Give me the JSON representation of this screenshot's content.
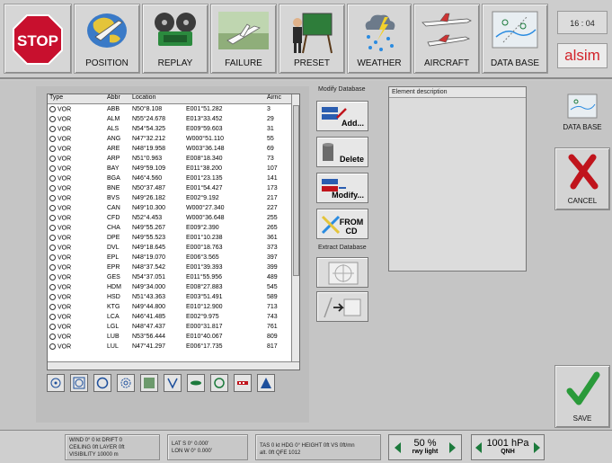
{
  "toolbar": {
    "stop": "STOP",
    "position": "POSITION",
    "replay": "REPLAY",
    "failure": "FAILURE",
    "preset": "PRESET",
    "weather": "WEATHER",
    "aircraft": "AIRCRAFT",
    "database": "DATA BASE",
    "clock": "16 : 04",
    "brand": "alsim"
  },
  "list": {
    "headers": [
      "Type",
      "Abbr",
      "Location",
      "Airnc"
    ],
    "rows": [
      [
        "VOR",
        "ABB",
        "N50°8.108",
        "E001°51.282",
        "3"
      ],
      [
        "VOR",
        "ALM",
        "N55°24.678",
        "E013°33.452",
        "29"
      ],
      [
        "VOR",
        "ALS",
        "N54°54.325",
        "E009°59.603",
        "31"
      ],
      [
        "VOR",
        "ANG",
        "N47°32.212",
        "W000°51.110",
        "55"
      ],
      [
        "VOR",
        "ARE",
        "N48°19.958",
        "W003°36.148",
        "69"
      ],
      [
        "VOR",
        "ARP",
        "N51°0.963",
        "E008°18.340",
        "73"
      ],
      [
        "VOR",
        "BAY",
        "N49°59.109",
        "E011°38.200",
        "107"
      ],
      [
        "VOR",
        "BGA",
        "N46°4.560",
        "E001°23.135",
        "141"
      ],
      [
        "VOR",
        "BNE",
        "N50°37.487",
        "E001°54.427",
        "173"
      ],
      [
        "VOR",
        "BVS",
        "N49°26.182",
        "E002°9.192",
        "217"
      ],
      [
        "VOR",
        "CAN",
        "N49°10.300",
        "W000°27.340",
        "227"
      ],
      [
        "VOR",
        "CFD",
        "N52°4.453",
        "W000°36.648",
        "255"
      ],
      [
        "VOR",
        "CHA",
        "N49°55.267",
        "E009°2.390",
        "265"
      ],
      [
        "VOR",
        "DPE",
        "N49°55.523",
        "E001°10.238",
        "361"
      ],
      [
        "VOR",
        "DVL",
        "N49°18.645",
        "E000°18.763",
        "373"
      ],
      [
        "VOR",
        "EPL",
        "N48°19.070",
        "E006°3.565",
        "397"
      ],
      [
        "VOR",
        "EPR",
        "N48°37.542",
        "E001°39.393",
        "399"
      ],
      [
        "VOR",
        "GES",
        "N54°37.051",
        "E011°55.956",
        "489"
      ],
      [
        "VOR",
        "HDM",
        "N49°34.000",
        "E008°27.883",
        "545"
      ],
      [
        "VOR",
        "HSD",
        "N51°43.363",
        "E003°51.491",
        "589"
      ],
      [
        "VOR",
        "KTG",
        "N49°44.800",
        "E010°12.900",
        "713"
      ],
      [
        "VOR",
        "LCA",
        "N46°41.485",
        "E002°9.975",
        "743"
      ],
      [
        "VOR",
        "LGL",
        "N48°47.437",
        "E000°31.817",
        "761"
      ],
      [
        "VOR",
        "LUB",
        "N53°56.444",
        "E010°40.067",
        "809"
      ],
      [
        "VOR",
        "LUL",
        "N47°41.297",
        "E006°17.735",
        "817"
      ]
    ]
  },
  "modify": {
    "title": "Modify Database",
    "add": "Add...",
    "delete": "Delete",
    "modify": "Modify...",
    "from_cd": "FROM CD",
    "extract_title": "Extract Database"
  },
  "description": {
    "title": "Element description"
  },
  "right": {
    "database": "DATA BASE",
    "cancel": "CANCEL",
    "save": "SAVE"
  },
  "status": {
    "wind_l1": "WIND 0° 0 kt DRIFT 0",
    "wind_l2": "CEILING 0ft LAYER 0ft",
    "wind_l3": "VISIBILITY 10000 m",
    "lat": "LAT S 0° 0.000'",
    "lon": "LON W 0° 0.000'",
    "tas_l1": "TAS 0 kt HDG 0° HEIGHT 0ft VS 0ft/mn",
    "tas_l2": "alt. 0ft QFE 1012",
    "rwy_value": "50 %",
    "rwy_label": "rwy light",
    "qnh_value": "1001 hPa",
    "qnh_label": "QNH"
  },
  "colors": {
    "stop_red": "#c8102e",
    "brand_red": "#d2232a",
    "go_green": "#1c7a3c",
    "cancel_red": "#c0141c",
    "save_green": "#2a9a3a"
  }
}
